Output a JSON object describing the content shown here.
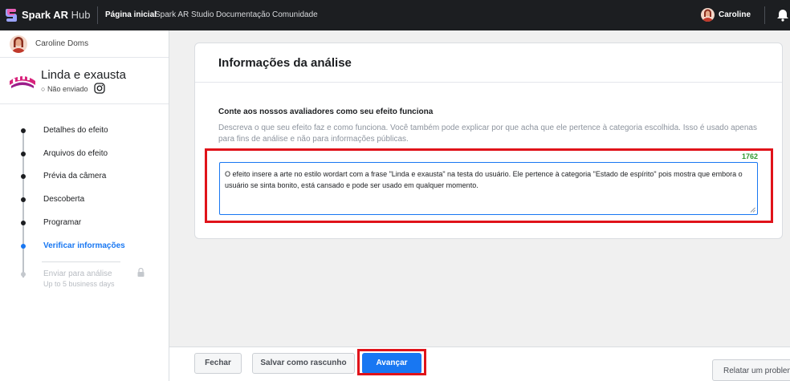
{
  "topbar": {
    "brand_main": "Spark AR",
    "brand_sub": "Hub",
    "nav": [
      "Página inicial",
      "Spark AR Studio",
      "Documentação",
      "Comunidade"
    ],
    "user": "Caroline",
    "logo_icon": "spark-ar-logo-icon",
    "bell_icon": "bell-icon"
  },
  "sidebar": {
    "user": "Caroline Doms",
    "project": {
      "title": "Linda e exausta",
      "status": "Não enviado",
      "platform_icon": "instagram-icon"
    },
    "steps": [
      {
        "label": "Detalhes do efeito",
        "state": "done"
      },
      {
        "label": "Arquivos do efeito",
        "state": "done"
      },
      {
        "label": "Prévia da câmera",
        "state": "done"
      },
      {
        "label": "Descoberta",
        "state": "done"
      },
      {
        "label": "Programar",
        "state": "done"
      },
      {
        "label": "Verificar informações",
        "state": "active"
      },
      {
        "label": "Enviar para análise",
        "state": "disabled"
      }
    ],
    "submit_note": "Up to 5 business days"
  },
  "panel": {
    "title": "Informações da análise",
    "question": "Conte aos nossos avaliadores como seu efeito funciona",
    "help": "Descreva o que seu efeito faz e como funciona. Você também pode explicar por que acha que ele pertence à categoria escolhida. Isso é usado apenas para fins de análise e não para informações públicas.",
    "char_count": "1762",
    "answer": "O efeito insere a arte no estilo wordart com a frase \"Linda e exausta\" na testa do usuário. Ele pertence à categoria \"Estado de espírito\" pois mostra que embora o usuário se sinta bonito, está cansado e pode ser usado em qualquer momento."
  },
  "footer": {
    "close": "Fechar",
    "save_draft": "Salvar como rascunho",
    "next": "Avançar",
    "report": "Relatar um problema"
  },
  "colors": {
    "accent": "#1877f2",
    "highlight": "#e0131a",
    "counter": "#2e9a2e",
    "topbar": "#1c1e21"
  }
}
